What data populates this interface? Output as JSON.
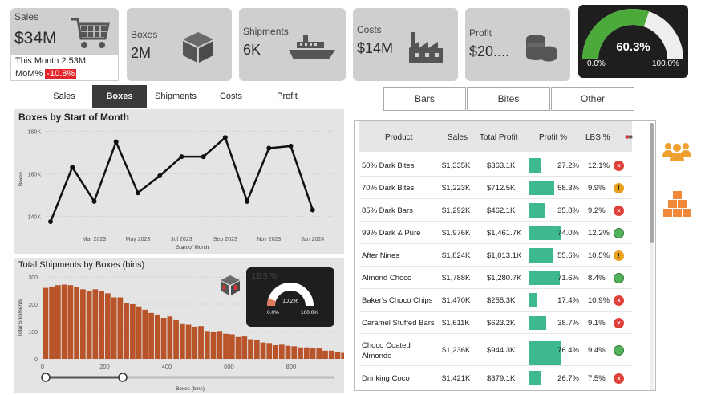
{
  "kpis": {
    "sales": {
      "label": "Sales",
      "value": "$34M",
      "this_month": "This Month 2.53M",
      "mom_label": "MoM%",
      "mom_value": "-10.8%"
    },
    "boxes": {
      "label": "Boxes",
      "value": "2M"
    },
    "shipments": {
      "label": "Shipments",
      "value": "6K"
    },
    "costs": {
      "label": "Costs",
      "value": "$14M"
    },
    "profit": {
      "label": "Profit",
      "value": "$20...."
    }
  },
  "gauge": {
    "value": "60.3%",
    "min": "0.0%",
    "max": "100.0%",
    "fraction": 0.603
  },
  "tabs": [
    "Sales",
    "Boxes",
    "Shipments",
    "Costs",
    "Profit"
  ],
  "active_tab": "Boxes",
  "segments": [
    "Bars",
    "Bites",
    "Other"
  ],
  "chart_data": [
    {
      "type": "line",
      "title": "Boxes by Start of Month",
      "xlabel": "Start of Month",
      "ylabel": "Boxes",
      "x_tick_labels": [
        "Mar 2023",
        "May 2023",
        "Jul 2023",
        "Sep 2023",
        "Nov 2023",
        "Jan 2024"
      ],
      "y_tick_labels": [
        "140K",
        "160K",
        "180K"
      ],
      "ylim": [
        133000,
        182000
      ],
      "x": [
        "Jan 2023",
        "Feb 2023",
        "Mar 2023",
        "Apr 2023",
        "May 2023",
        "Jun 2023",
        "Jul 2023",
        "Aug 2023",
        "Sep 2023",
        "Oct 2023",
        "Nov 2023",
        "Dec 2023",
        "Jan 2024",
        "Feb 2024"
      ],
      "values": [
        137500,
        163000,
        147000,
        175000,
        151000,
        159000,
        168000,
        168000,
        177000,
        147000,
        172000,
        173000,
        143000,
        null
      ]
    },
    {
      "type": "bar",
      "title": "Total Shipments by Boxes (bins)",
      "xlabel": "Boxes (bins)",
      "ylabel": "Total Shipments",
      "x_tick_labels": [
        "0",
        "200",
        "400",
        "600",
        "800"
      ],
      "y_tick_labels": [
        "0",
        "100",
        "200",
        "300"
      ],
      "ylim": [
        0,
        300
      ],
      "bin_width": 20,
      "values": [
        260,
        265,
        270,
        272,
        270,
        262,
        255,
        250,
        255,
        248,
        240,
        225,
        225,
        205,
        200,
        192,
        180,
        168,
        162,
        150,
        155,
        142,
        130,
        125,
        118,
        120,
        102,
        100,
        102,
        92,
        90,
        80,
        82,
        72,
        68,
        60,
        58,
        50,
        52,
        48,
        46,
        42,
        42,
        40,
        38,
        30,
        30,
        26,
        22,
        20
      ]
    }
  ],
  "mini_gauge": {
    "label": "LBS %",
    "value": "10.2%",
    "min": "0.0%",
    "max": "100.0%",
    "fraction": 0.102
  },
  "table": {
    "headers": [
      "Product",
      "Sales",
      "Total Profit",
      "Profit %",
      "LBS %"
    ],
    "rows": [
      {
        "product": "50% Dark Bites",
        "sales": "$1,335K",
        "profit": "$363.1K",
        "pct": "27.2%",
        "pct_v": 27.2,
        "lbs": "12.1%",
        "status": "red"
      },
      {
        "product": "70% Dark Bites",
        "sales": "$1,223K",
        "profit": "$712.5K",
        "pct": "58.3%",
        "pct_v": 58.3,
        "lbs": "9.9%",
        "status": "amber"
      },
      {
        "product": "85% Dark Bars",
        "sales": "$1,292K",
        "profit": "$462.1K",
        "pct": "35.8%",
        "pct_v": 35.8,
        "lbs": "9.2%",
        "status": "red"
      },
      {
        "product": "99% Dark & Pure",
        "sales": "$1,976K",
        "profit": "$1,461.7K",
        "pct": "74.0%",
        "pct_v": 74.0,
        "lbs": "12.2%",
        "status": "green"
      },
      {
        "product": "After Nines",
        "sales": "$1,824K",
        "profit": "$1,013.1K",
        "pct": "55.6%",
        "pct_v": 55.6,
        "lbs": "10.5%",
        "status": "amber"
      },
      {
        "product": "Almond Choco",
        "sales": "$1,788K",
        "profit": "$1,280.7K",
        "pct": "71.6%",
        "pct_v": 71.6,
        "lbs": "8.4%",
        "status": "green"
      },
      {
        "product": "Baker's Choco Chips",
        "sales": "$1,470K",
        "profit": "$255.3K",
        "pct": "17.4%",
        "pct_v": 17.4,
        "lbs": "10.9%",
        "status": "red"
      },
      {
        "product": "Caramel Stuffed Bars",
        "sales": "$1,611K",
        "profit": "$623.2K",
        "pct": "38.7%",
        "pct_v": 38.7,
        "lbs": "9.1%",
        "status": "red"
      },
      {
        "product": "Choco Coated",
        "product2": "Almonds",
        "sales": "$1,236K",
        "profit": "$944.3K",
        "pct": "76.4%",
        "pct_v": 76.4,
        "lbs": "9.4%",
        "status": "green"
      },
      {
        "product": "Drinking Coco",
        "sales": "$1,421K",
        "profit": "$379.1K",
        "pct": "26.7%",
        "pct_v": 26.7,
        "lbs": "7.5%",
        "status": "red"
      }
    ]
  },
  "colors": {
    "accent_orange": "#b9532a",
    "gauge_green": "#4caa3a",
    "table_bar": "#3db890",
    "status_red": "#e0403a",
    "status_amber": "#e8a11f",
    "status_green": "#54b35a",
    "icon_orange": "#f0a030"
  }
}
